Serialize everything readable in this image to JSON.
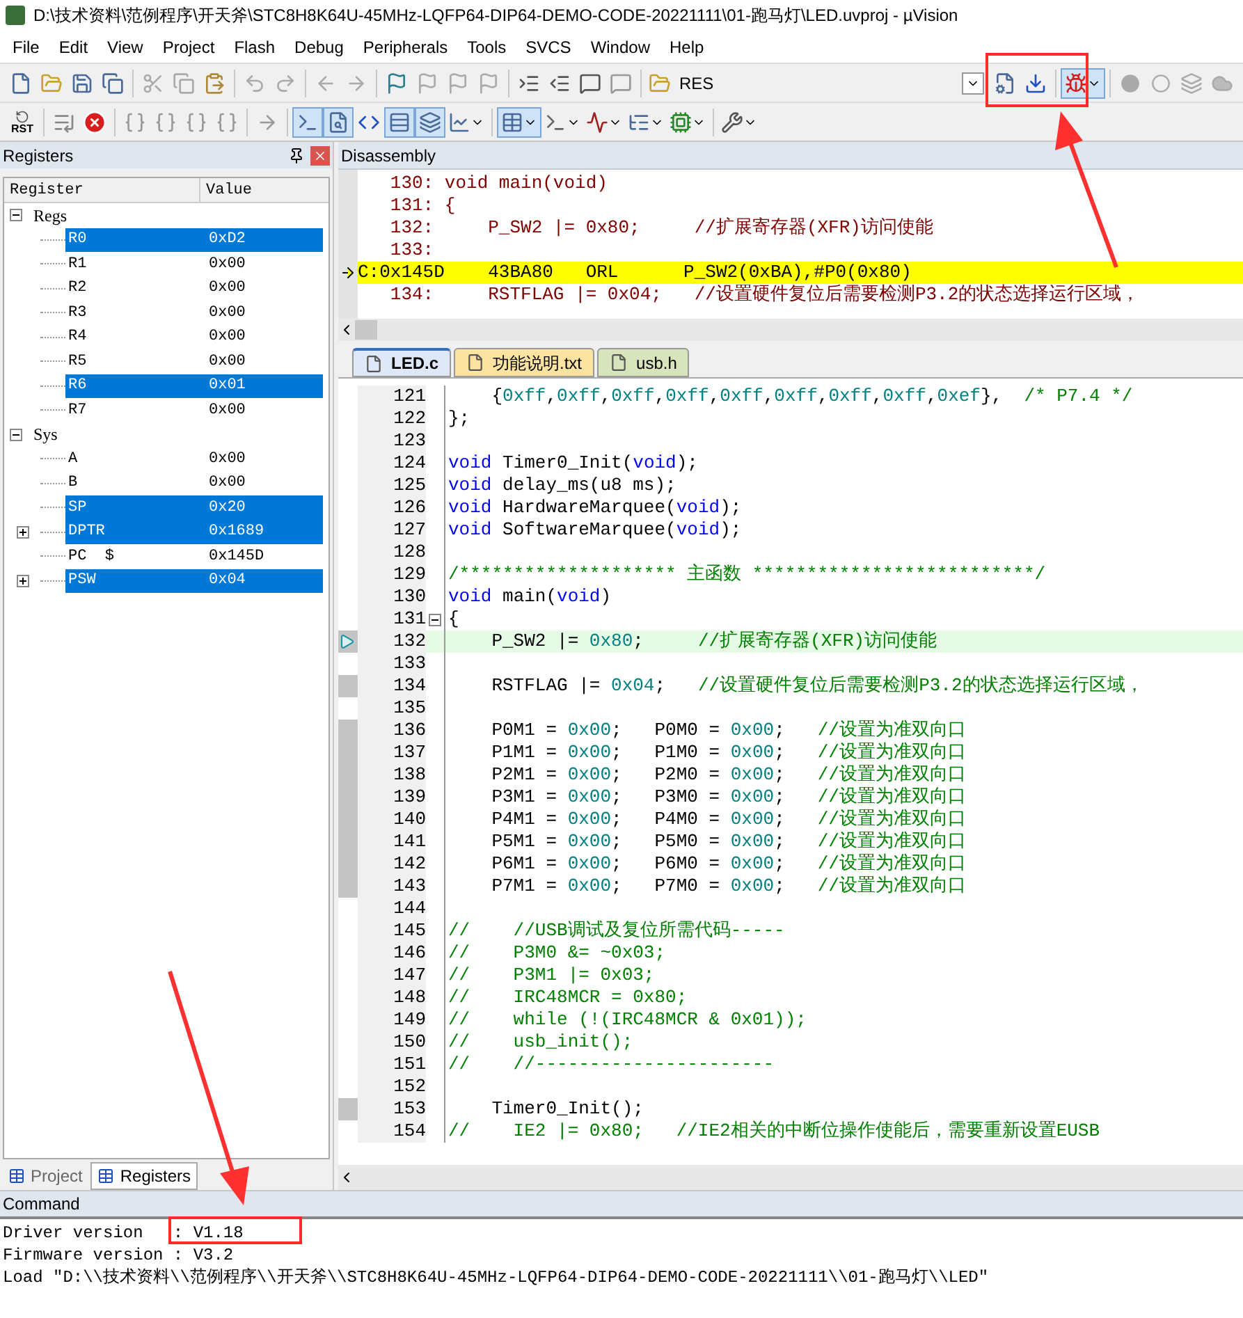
{
  "window": {
    "title": "D:\\技术资料\\范例程序\\开天斧\\STC8H8K64U-45MHz-LQFP64-DIP64-DEMO-CODE-20221111\\01-跑马灯\\LED.uvproj - µVision"
  },
  "menu": [
    "File",
    "Edit",
    "View",
    "Project",
    "Flash",
    "Debug",
    "Peripherals",
    "Tools",
    "SVCS",
    "Window",
    "Help"
  ],
  "toolbar": {
    "res_label": "RES",
    "rst_label": "RST"
  },
  "registers": {
    "title": "Registers",
    "columns": [
      "Register",
      "Value"
    ],
    "groups": [
      {
        "name": "Regs",
        "expanded": true,
        "children": [
          {
            "name": "R0",
            "value": "0xD2",
            "changed": true
          },
          {
            "name": "R1",
            "value": "0x00",
            "changed": false
          },
          {
            "name": "R2",
            "value": "0x00",
            "changed": false
          },
          {
            "name": "R3",
            "value": "0x00",
            "changed": false
          },
          {
            "name": "R4",
            "value": "0x00",
            "changed": false
          },
          {
            "name": "R5",
            "value": "0x00",
            "changed": false
          },
          {
            "name": "R6",
            "value": "0x01",
            "changed": true
          },
          {
            "name": "R7",
            "value": "0x00",
            "changed": false
          }
        ]
      },
      {
        "name": "Sys",
        "expanded": true,
        "children": [
          {
            "name": "A",
            "value": "0x00",
            "changed": false
          },
          {
            "name": "B",
            "value": "0x00",
            "changed": false
          },
          {
            "name": "SP",
            "value": "0x20",
            "changed": true
          },
          {
            "name": "DPTR",
            "value": "0x1689",
            "changed": true,
            "expanded": false
          },
          {
            "name": "PC  $",
            "value": "0x145D",
            "changed": false
          },
          {
            "name": "PSW",
            "value": "0x04",
            "changed": true,
            "expanded": false
          }
        ]
      }
    ]
  },
  "panel_tabs": [
    {
      "label": "Project",
      "selected": false
    },
    {
      "label": "Registers",
      "selected": true
    }
  ],
  "disassembly": {
    "title": "Disassembly",
    "lines": [
      {
        "kind": "source",
        "text": "   130: void main(void)"
      },
      {
        "kind": "source",
        "text": "   131: {"
      },
      {
        "kind": "source",
        "text": "   132:     P_SW2 |= 0x80;     //扩展寄存器(XFR)访问使能"
      },
      {
        "kind": "source",
        "text": "   133:"
      },
      {
        "kind": "asm",
        "text": "C:0x145D    43BA80   ORL      P_SW2(0xBA),#P0(0x80)"
      },
      {
        "kind": "source",
        "text": "   134:     RSTFLAG |= 0x04;   //设置硬件复位后需要检测P3.2的状态选择运行区域，"
      }
    ]
  },
  "editor_tabs": [
    {
      "label": "LED.c",
      "selected": true,
      "color": "#dfe8f6"
    },
    {
      "label": "功能说明.txt",
      "selected": false,
      "color": "#fce4a0"
    },
    {
      "label": "usb.h",
      "selected": false,
      "color": "#d8e4bc"
    }
  ],
  "code": [
    {
      "number": "121",
      "segments": [
        {
          "kind": "plain",
          "text": "    {"
        },
        {
          "kind": "number",
          "text": "0xff"
        },
        {
          "kind": "plain",
          "text": ","
        },
        {
          "kind": "number",
          "text": "0xff"
        },
        {
          "kind": "plain",
          "text": ","
        },
        {
          "kind": "number",
          "text": "0xff"
        },
        {
          "kind": "plain",
          "text": ","
        },
        {
          "kind": "number",
          "text": "0xff"
        },
        {
          "kind": "plain",
          "text": ","
        },
        {
          "kind": "number",
          "text": "0xff"
        },
        {
          "kind": "plain",
          "text": ","
        },
        {
          "kind": "number",
          "text": "0xff"
        },
        {
          "kind": "plain",
          "text": ","
        },
        {
          "kind": "number",
          "text": "0xff"
        },
        {
          "kind": "plain",
          "text": ","
        },
        {
          "kind": "number",
          "text": "0xff"
        },
        {
          "kind": "plain",
          "text": ","
        },
        {
          "kind": "number",
          "text": "0xef"
        },
        {
          "kind": "plain",
          "text": "},  "
        },
        {
          "kind": "comment",
          "text": "/* P7.4 */"
        }
      ]
    },
    {
      "number": "122",
      "segments": [
        {
          "kind": "plain",
          "text": "};"
        }
      ]
    },
    {
      "number": "123"
    },
    {
      "number": "124",
      "segments": [
        {
          "kind": "keyword",
          "text": "void"
        },
        {
          "kind": "plain",
          "text": " Timer0_Init("
        },
        {
          "kind": "keyword",
          "text": "void"
        },
        {
          "kind": "plain",
          "text": ");"
        }
      ]
    },
    {
      "number": "125",
      "segments": [
        {
          "kind": "keyword",
          "text": "void"
        },
        {
          "kind": "plain",
          "text": " delay_ms(u8 ms);"
        }
      ]
    },
    {
      "number": "126",
      "segments": [
        {
          "kind": "keyword",
          "text": "void"
        },
        {
          "kind": "plain",
          "text": " HardwareMarquee("
        },
        {
          "kind": "keyword",
          "text": "void"
        },
        {
          "kind": "plain",
          "text": ");"
        }
      ]
    },
    {
      "number": "127",
      "segments": [
        {
          "kind": "keyword",
          "text": "void"
        },
        {
          "kind": "plain",
          "text": " SoftwareMarquee("
        },
        {
          "kind": "keyword",
          "text": "void"
        },
        {
          "kind": "plain",
          "text": ");"
        }
      ]
    },
    {
      "number": "128"
    },
    {
      "number": "129",
      "segments": [
        {
          "kind": "comment",
          "text": "/******************** 主函数 **************************/"
        }
      ]
    },
    {
      "number": "130",
      "segments": [
        {
          "kind": "keyword",
          "text": "void"
        },
        {
          "kind": "plain",
          "text": " main("
        },
        {
          "kind": "keyword",
          "text": "void"
        },
        {
          "kind": "plain",
          "text": ")"
        }
      ]
    },
    {
      "number": "131",
      "fold": true,
      "segments": [
        {
          "kind": "plain",
          "text": "{"
        }
      ]
    },
    {
      "number": "132",
      "current": true,
      "executable": true,
      "segments": [
        {
          "kind": "plain",
          "text": "    P_SW2 |= "
        },
        {
          "kind": "number",
          "text": "0x80"
        },
        {
          "kind": "plain",
          "text": ";     "
        },
        {
          "kind": "comment",
          "text": "//扩展寄存器(XFR)访问使能"
        }
      ]
    },
    {
      "number": "133"
    },
    {
      "number": "134",
      "executable": true,
      "segments": [
        {
          "kind": "plain",
          "text": "    RSTFLAG |= "
        },
        {
          "kind": "number",
          "text": "0x04"
        },
        {
          "kind": "plain",
          "text": ";   "
        },
        {
          "kind": "comment",
          "text": "//设置硬件复位后需要检测P3.2的状态选择运行区域，"
        }
      ]
    },
    {
      "number": "135"
    },
    {
      "number": "136",
      "executable": true,
      "segments": [
        {
          "kind": "plain",
          "text": "    P0M1 = "
        },
        {
          "kind": "number",
          "text": "0x00"
        },
        {
          "kind": "plain",
          "text": ";   P0M0 = "
        },
        {
          "kind": "number",
          "text": "0x00"
        },
        {
          "kind": "plain",
          "text": ";   "
        },
        {
          "kind": "comment",
          "text": "//设置为准双向口"
        }
      ]
    },
    {
      "number": "137",
      "executable": true,
      "segments": [
        {
          "kind": "plain",
          "text": "    P1M1 = "
        },
        {
          "kind": "number",
          "text": "0x00"
        },
        {
          "kind": "plain",
          "text": ";   P1M0 = "
        },
        {
          "kind": "number",
          "text": "0x00"
        },
        {
          "kind": "plain",
          "text": ";   "
        },
        {
          "kind": "comment",
          "text": "//设置为准双向口"
        }
      ]
    },
    {
      "number": "138",
      "executable": true,
      "segments": [
        {
          "kind": "plain",
          "text": "    P2M1 = "
        },
        {
          "kind": "number",
          "text": "0x00"
        },
        {
          "kind": "plain",
          "text": ";   P2M0 = "
        },
        {
          "kind": "number",
          "text": "0x00"
        },
        {
          "kind": "plain",
          "text": ";   "
        },
        {
          "kind": "comment",
          "text": "//设置为准双向口"
        }
      ]
    },
    {
      "number": "139",
      "executable": true,
      "segments": [
        {
          "kind": "plain",
          "text": "    P3M1 = "
        },
        {
          "kind": "number",
          "text": "0x00"
        },
        {
          "kind": "plain",
          "text": ";   P3M0 = "
        },
        {
          "kind": "number",
          "text": "0x00"
        },
        {
          "kind": "plain",
          "text": ";   "
        },
        {
          "kind": "comment",
          "text": "//设置为准双向口"
        }
      ]
    },
    {
      "number": "140",
      "executable": true,
      "segments": [
        {
          "kind": "plain",
          "text": "    P4M1 = "
        },
        {
          "kind": "number",
          "text": "0x00"
        },
        {
          "kind": "plain",
          "text": ";   P4M0 = "
        },
        {
          "kind": "number",
          "text": "0x00"
        },
        {
          "kind": "plain",
          "text": ";   "
        },
        {
          "kind": "comment",
          "text": "//设置为准双向口"
        }
      ]
    },
    {
      "number": "141",
      "executable": true,
      "segments": [
        {
          "kind": "plain",
          "text": "    P5M1 = "
        },
        {
          "kind": "number",
          "text": "0x00"
        },
        {
          "kind": "plain",
          "text": ";   P5M0 = "
        },
        {
          "kind": "number",
          "text": "0x00"
        },
        {
          "kind": "plain",
          "text": ";   "
        },
        {
          "kind": "comment",
          "text": "//设置为准双向口"
        }
      ]
    },
    {
      "number": "142",
      "executable": true,
      "segments": [
        {
          "kind": "plain",
          "text": "    P6M1 = "
        },
        {
          "kind": "number",
          "text": "0x00"
        },
        {
          "kind": "plain",
          "text": ";   P6M0 = "
        },
        {
          "kind": "number",
          "text": "0x00"
        },
        {
          "kind": "plain",
          "text": ";   "
        },
        {
          "kind": "comment",
          "text": "//设置为准双向口"
        }
      ]
    },
    {
      "number": "143",
      "executable": true,
      "segments": [
        {
          "kind": "plain",
          "text": "    P7M1 = "
        },
        {
          "kind": "number",
          "text": "0x00"
        },
        {
          "kind": "plain",
          "text": ";   P7M0 = "
        },
        {
          "kind": "number",
          "text": "0x00"
        },
        {
          "kind": "plain",
          "text": ";   "
        },
        {
          "kind": "comment",
          "text": "//设置为准双向口"
        }
      ]
    },
    {
      "number": "144"
    },
    {
      "number": "145",
      "segments": [
        {
          "kind": "comment",
          "text": "//    //USB调试及复位所需代码-----"
        }
      ]
    },
    {
      "number": "146",
      "segments": [
        {
          "kind": "comment",
          "text": "//    P3M0 &= ~0x03;"
        }
      ]
    },
    {
      "number": "147",
      "segments": [
        {
          "kind": "comment",
          "text": "//    P3M1 |= 0x03;"
        }
      ]
    },
    {
      "number": "148",
      "segments": [
        {
          "kind": "comment",
          "text": "//    IRC48MCR = 0x80;"
        }
      ]
    },
    {
      "number": "149",
      "segments": [
        {
          "kind": "comment",
          "text": "//    while (!(IRC48MCR & 0x01));"
        }
      ]
    },
    {
      "number": "150",
      "segments": [
        {
          "kind": "comment",
          "text": "//    usb_init();"
        }
      ]
    },
    {
      "number": "151",
      "segments": [
        {
          "kind": "comment",
          "text": "//    //----------------------"
        }
      ]
    },
    {
      "number": "152"
    },
    {
      "number": "153",
      "executable": true,
      "segments": [
        {
          "kind": "plain",
          "text": "    Timer0_Init();"
        }
      ]
    },
    {
      "number": "154",
      "segments": [
        {
          "kind": "comment",
          "text": "//    IE2 |= 0x80;   //IE2相关的中断位操作使能后，需要重新设置EUSB"
        }
      ]
    }
  ],
  "command": {
    "title": "Command",
    "lines": [
      "Driver version   : V1.18",
      "Firmware version : V3.2",
      "Load \"D:\\\\技术资料\\\\范例程序\\\\开天斧\\\\STC8H8K64U-45MHz-LQFP64-DIP64-DEMO-CODE-20221111\\\\01-跑马灯\\\\LED\""
    ]
  }
}
